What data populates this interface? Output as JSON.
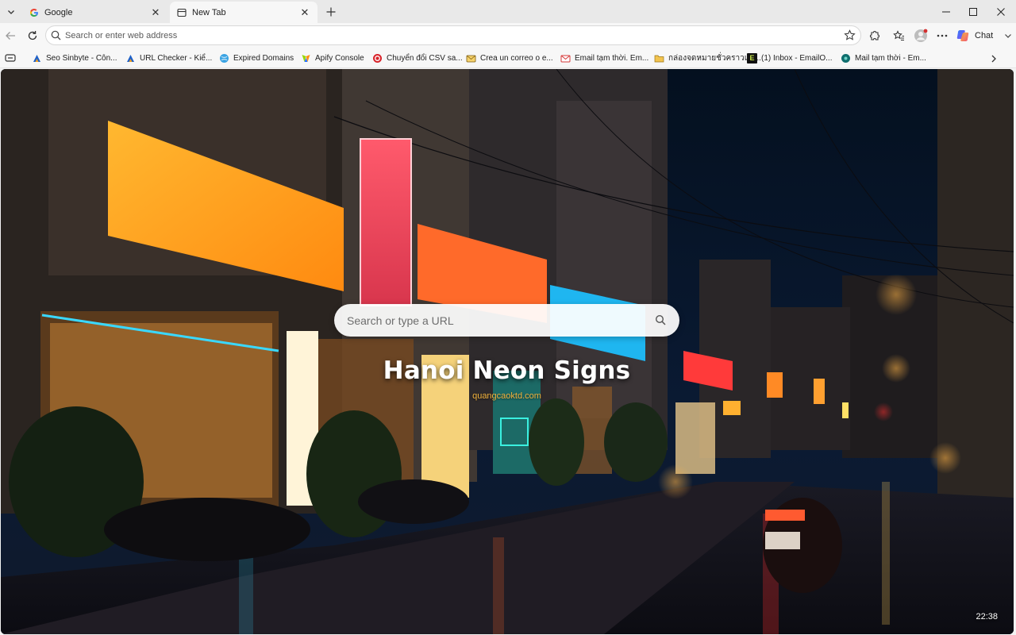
{
  "tabs": [
    {
      "title": "Google",
      "icon": "google-icon",
      "active": false
    },
    {
      "title": "New Tab",
      "icon": "newtab-page-icon",
      "active": true
    }
  ],
  "toolbar": {
    "omnibox_placeholder": "Search or enter web address",
    "chat_label": "Chat"
  },
  "bookmarks": [
    {
      "label": "Seo Sinbyte - Côn...",
      "icon": "sinbyte-icon"
    },
    {
      "label": "URL Checker - Kiể...",
      "icon": "sinbyte-icon"
    },
    {
      "label": "Expired Domains",
      "icon": "globe-icon"
    },
    {
      "label": "Apify Console",
      "icon": "apify-icon"
    },
    {
      "label": "Chuyển đổi CSV sa...",
      "icon": "red-circle-icon"
    },
    {
      "label": "Crea un correo o e...",
      "icon": "mailbox-icon"
    },
    {
      "label": "Email tạm thời. Em...",
      "icon": "envelope-icon"
    },
    {
      "label": "กล่องจดหมายชั่วคราวแป...",
      "icon": "folder-mail-icon"
    },
    {
      "label": "(1) Inbox - EmailO...",
      "icon": "e-icon",
      "glyph": "E"
    },
    {
      "label": "Mail tạm thời - Em...",
      "icon": "teal-circle-icon"
    }
  ],
  "newtab": {
    "search_placeholder": "Search or type a URL",
    "title": "Hanoi Neon Signs",
    "subtitle": "quangcaoktd.com",
    "clock": "22:38"
  },
  "colors": {
    "accent_subtitle": "#f3b43e",
    "tabstrip_bg": "#e9e9e9",
    "toolbar_bg": "#f7f7f7"
  }
}
